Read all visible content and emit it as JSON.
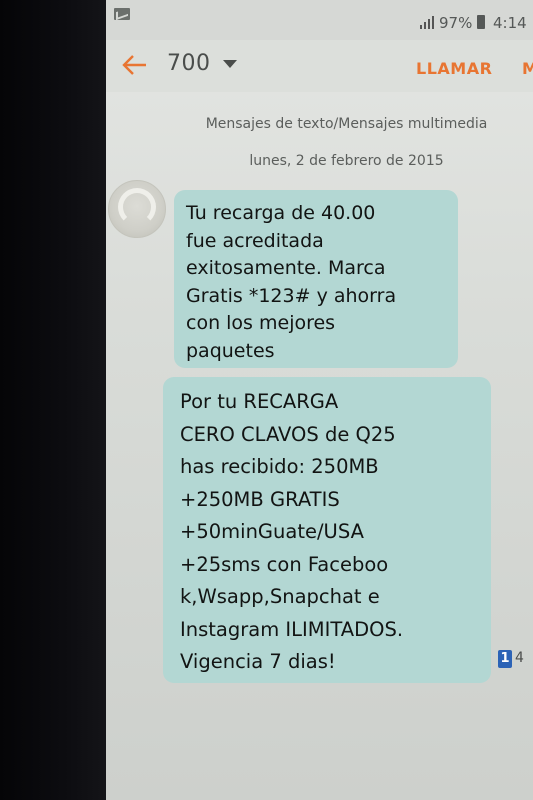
{
  "status_bar": {
    "battery": "97%",
    "time": "4:14"
  },
  "app_bar": {
    "contact": "700",
    "call_label": "LLAMAR",
    "more_label": "M"
  },
  "thread": {
    "type_label": "Mensajes de texto/Mensajes multimedia",
    "date": "lunes, 2 de febrero de 2015"
  },
  "messages": [
    {
      "text": "Tu recarga de 40.00\nfue acreditada\nexitosamente. Marca\nGratis *123# y ahorra\ncon los mejores\npaquetes"
    },
    {
      "text": "Por tu RECARGA\nCERO CLAVOS de Q25\nhas recibido: 250MB\n+250MB GRATIS\n+50minGuate/USA\n+25sms con Faceboo\nk,Wsapp,Snapchat e\nInstagram ILIMITADOS.\nVigencia 7 dias!",
      "sim": "1",
      "time": "4"
    }
  ],
  "colors": {
    "accent": "#e87532",
    "bubble": "#b3d7d3",
    "sim_badge": "#2c63b6"
  },
  "icons": [
    "notification-icon",
    "signal-icon",
    "battery-icon",
    "back-arrow-icon",
    "chevron-down-icon",
    "contact-avatar-icon"
  ]
}
